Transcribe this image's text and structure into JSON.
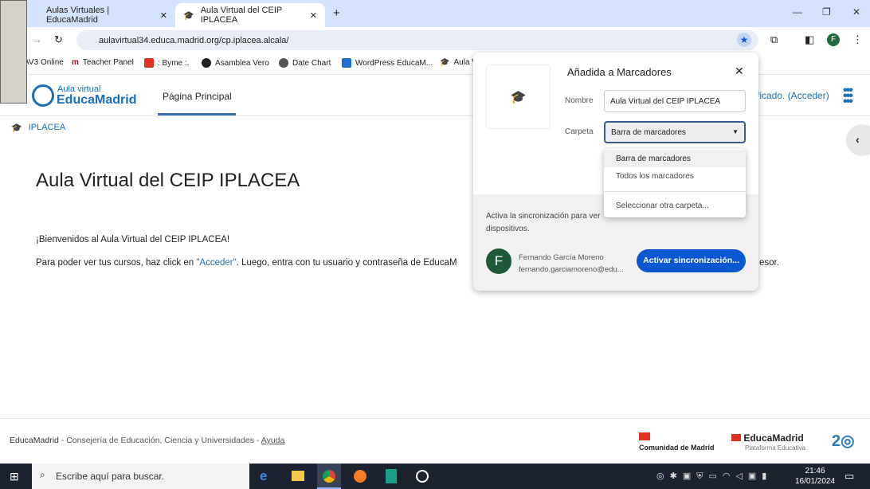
{
  "browser": {
    "tabs": [
      {
        "label": "Aulas Virtuales | EducaMadrid"
      },
      {
        "label": "Aula Virtual del CEIP IPLACEA"
      }
    ],
    "url": "aulavirtual34.educa.madrid.org/cp.iplacea.alcala/",
    "profile_initial": "F",
    "bookmarks": [
      "AV3 Online",
      "Teacher Panel",
      ": Byme :.",
      "Asamblea Vero",
      "Date Chart",
      "WordPress EducaM...",
      "Aula V"
    ]
  },
  "site": {
    "logo_top": "Aula virtual",
    "logo_bottom": "EducaMadrid",
    "nav": "Página Principal",
    "login_fragment": "ficado. (Acceder)",
    "breadcrumb": "IPLACEA",
    "title": "Aula Virtual del CEIP IPLACEA",
    "welcome": "¡Bienvenidos al Aula Virtual del CEIP IPLACEA!",
    "instr_pre": "Para poder ver tus cursos, haz click en ",
    "instr_link": "\"Acceder\"",
    "instr_post": ". Luego, entra con tu usuario y contraseña de EducaM",
    "instr_end": "esor.",
    "footer_org": "EducaMadrid",
    "footer_text": " - Consejería de Educación, Ciencia y Universidades - ",
    "footer_link": "Ayuda",
    "footer_logo1": "Comunidad de Madrid",
    "footer_logo2": "EducaMadrid",
    "footer_logo2_sub": "Plataforma Educativa"
  },
  "popup": {
    "title": "Añadida a Marcadores",
    "name_label": "Nombre",
    "name_value": "Aula Virtual del CEIP IPLACEA",
    "folder_label": "Carpeta",
    "folder_value": "Barra de marcadores",
    "options": [
      "Barra de marcadores",
      "Todos los marcadores",
      "Seleccionar otra carpeta..."
    ],
    "sync_text": "Activa la sincronización para ver",
    "sync_text2": "dispositivos.",
    "user_name": "Fernando García Moreno",
    "user_email": "fernando.garciamoreno@edu...",
    "sync_button": "Activar sincronización..."
  },
  "taskbar": {
    "search_placeholder": "Escribe aquí para buscar.",
    "time": "21:46",
    "date": "16/01/2024"
  }
}
